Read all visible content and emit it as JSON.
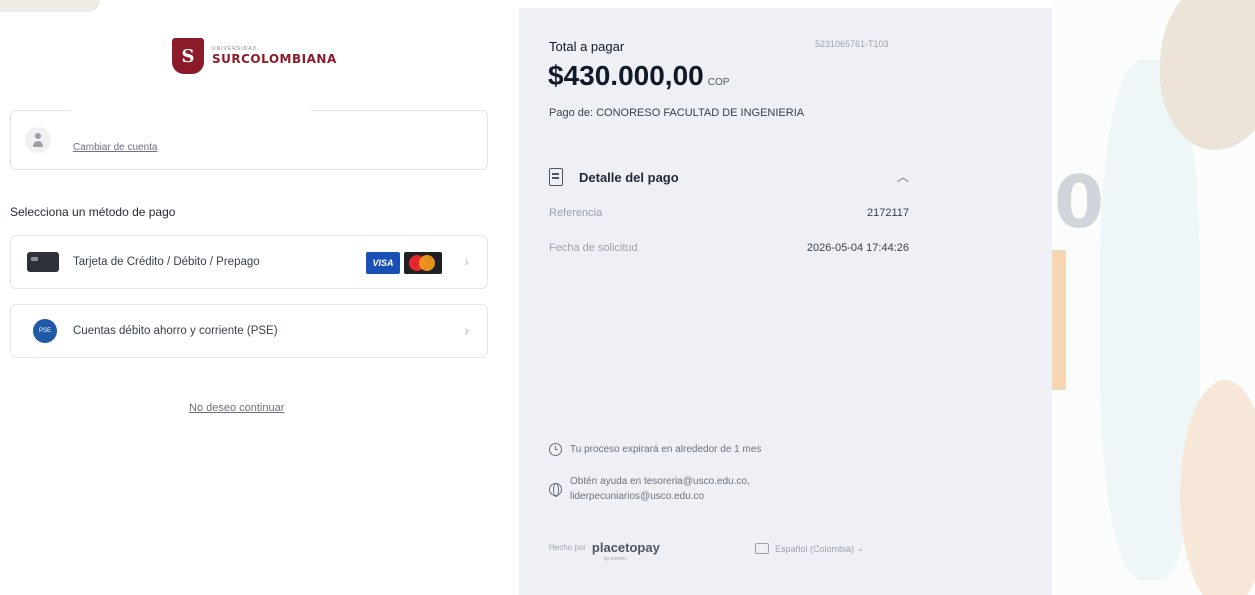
{
  "brand": {
    "logo_small": "UNIVERSIDAD",
    "logo_name": "SURCOLOMBIANA",
    "shield_letter": "S"
  },
  "account": {
    "change_link": "Cambiar de cuenta"
  },
  "methods": {
    "title": "Selecciona un método de pago",
    "items": [
      {
        "label": "Tarjeta de Crédito / Débito / Prepago",
        "icon": "credit-card-icon"
      },
      {
        "label": "Cuentas débito ahorro y corriente (PSE)",
        "icon": "pse-icon"
      }
    ],
    "visa": "VISA",
    "pse_icon_text": "PSE"
  },
  "no_continue": "No deseo continuar",
  "summary": {
    "total_label": "Total a pagar",
    "ref_code": "5231065761-T103",
    "amount": "$430.000,00",
    "currency": "COP",
    "pay_of": "Pago de: CONORESO FACULTAD DE INGENIERIA",
    "detail_title": "Detalle del pago",
    "rows": [
      {
        "key": "Referencia",
        "value": "2172117"
      },
      {
        "key": "Fecha de solicitud",
        "value": "2026-05-04 17:44:26"
      }
    ],
    "expiry": "Tu proceso expirará en alrededor de 1 mes",
    "help_line1": "Obtén ayuda en tesoreria@usco.edu.co,",
    "help_line2": "liderpecuniarios@usco.edu.co",
    "made_by": "Hecho por",
    "provider": "placetopay",
    "provider_sub": "by evertec",
    "language": "Español (Colombia)"
  },
  "background_text": "0"
}
